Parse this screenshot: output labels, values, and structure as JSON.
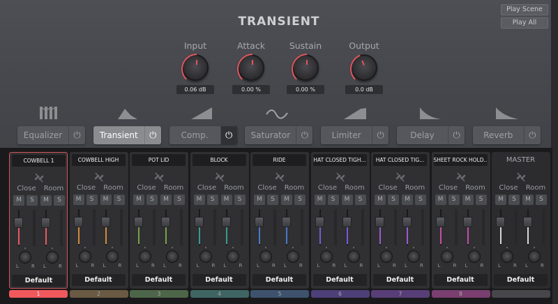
{
  "header": {
    "title": "TRANSIENT",
    "play_scene": "Play Scene",
    "play_all": "Play All"
  },
  "knobs": [
    {
      "label": "Input",
      "value": "0.06 dB",
      "level": 0.5
    },
    {
      "label": "Attack",
      "value": "0.00 %",
      "level": 0.5
    },
    {
      "label": "Sustain",
      "value": "0.00 %",
      "level": 0.5
    },
    {
      "label": "Output",
      "value": "0.0 dB",
      "level": 0.42
    }
  ],
  "accent": "#e0565c",
  "effects": [
    {
      "label": "Equalizer",
      "icon": "eq-bars-icon",
      "active": false,
      "power": false
    },
    {
      "label": "Transient",
      "icon": "transient-envelope-icon",
      "active": true,
      "power": false
    },
    {
      "label": "Comp.",
      "icon": "compressor-curve-icon",
      "active": false,
      "power": true
    },
    {
      "label": "Saturator",
      "icon": "saturator-wave-icon",
      "active": false,
      "power": false
    },
    {
      "label": "Limiter",
      "icon": "limiter-curve-icon",
      "active": false,
      "power": false
    },
    {
      "label": "Delay",
      "icon": "delay-decay-icon",
      "active": false,
      "power": false
    },
    {
      "label": "Reverb",
      "icon": "reverb-decay-icon",
      "active": false,
      "power": false
    }
  ],
  "mixer": {
    "close_label": "Close",
    "room_label": "Room",
    "mute_label": "M",
    "solo_label": "S",
    "left_label": "L",
    "right_label": "R",
    "channels": [
      {
        "name": "COWBELL 1",
        "preset": "Default",
        "number": "1",
        "color": "#e85a5e",
        "tab": "#f0595c",
        "selected": true
      },
      {
        "name": "COWBELL HIGH",
        "preset": "Default",
        "number": "2",
        "color": "#d08a3a",
        "tab": "#6a5a44"
      },
      {
        "name": "POT LID",
        "preset": "Default",
        "number": "3",
        "color": "#7aa04a",
        "tab": "#4d6548"
      },
      {
        "name": "BLOCK",
        "preset": "Default",
        "number": "4",
        "color": "#3a9a90",
        "tab": "#3f6563"
      },
      {
        "name": "RIDE",
        "preset": "Default",
        "number": "5",
        "color": "#4a78c8",
        "tab": "#3e526e"
      },
      {
        "name": "HAT CLOSED TIGH...",
        "preset": "Default",
        "number": "6",
        "color": "#7a5ad0",
        "tab": "#4d3f78"
      },
      {
        "name": "HAT CLOSED TIG...",
        "preset": "Default",
        "number": "7",
        "color": "#9a5ad0",
        "tab": "#583e78"
      },
      {
        "name": "SHEET ROCK HOLD...",
        "preset": "Default",
        "number": "8",
        "color": "#c050a8",
        "tab": "#7a3e70"
      },
      {
        "name": "MASTER",
        "preset": "Default",
        "number": "",
        "color": "#d8d8d8",
        "tab": "#47474b",
        "master": true
      }
    ]
  }
}
